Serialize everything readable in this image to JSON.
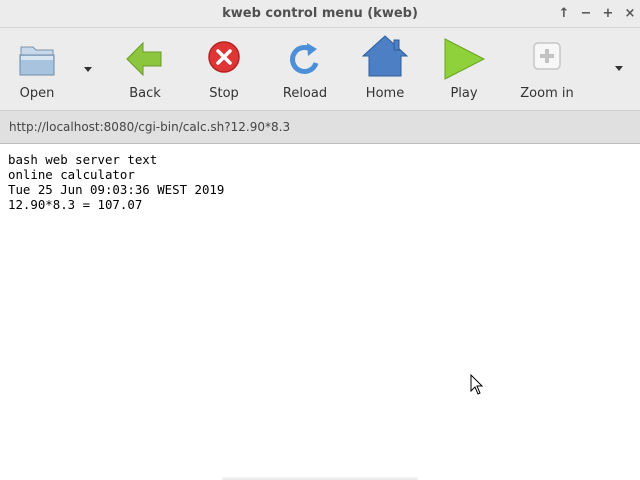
{
  "window": {
    "title": "kweb control menu (kweb)",
    "controls": {
      "up": "↑",
      "minimize": "−",
      "maximize": "+",
      "close": "×"
    }
  },
  "toolbar": {
    "open": "Open",
    "back": "Back",
    "stop": "Stop",
    "reload": "Reload",
    "home": "Home",
    "play": "Play",
    "zoom_in": "Zoom in"
  },
  "address": {
    "url": "http://localhost:8080/cgi-bin/calc.sh?12.90*8.3"
  },
  "page": {
    "lines": [
      "bash web server text",
      "online calculator",
      "Tue 25 Jun 09:03:36 WEST 2019",
      "12.90*8.3 = 107.07"
    ]
  },
  "colors": {
    "chrome": "#ececec",
    "back_arrow": "#8cc63f",
    "stop": "#e03535",
    "reload": "#4a8fd8",
    "home": "#4d7fc4",
    "play": "#8fd13a"
  }
}
